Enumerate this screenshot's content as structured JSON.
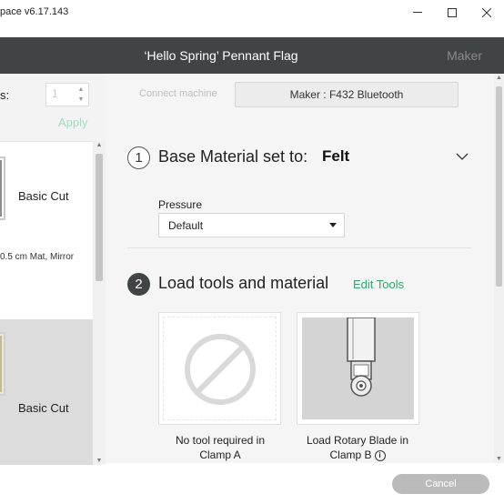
{
  "window": {
    "app_title": "pace  v6.17.143",
    "minimize_icon": "minimize-icon",
    "maximize_icon": "maximize-icon",
    "close_icon": "close-icon"
  },
  "header": {
    "back_icon": "chevron-left-icon",
    "project_title": "‘Hello Spring’ Pennant Flag",
    "machine_type": "Maker"
  },
  "copies": {
    "label": "s:",
    "value": "1",
    "apply_label": "Apply"
  },
  "mats": [
    {
      "label": "Basic Cut",
      "subtitle": "0.5 cm Mat, Mirror",
      "selected": false
    },
    {
      "label": "Basic Cut",
      "selected": true
    }
  ],
  "connect": {
    "label": "Connect machine",
    "machine": "Maker : F432 Bluetooth"
  },
  "step1": {
    "number": "1",
    "title": "Base Material set to:",
    "material": "Felt",
    "expand_icon": "chevron-down-icon"
  },
  "pressure": {
    "label": "Pressure",
    "selected": "Default"
  },
  "step2": {
    "number": "2",
    "title": "Load tools and material",
    "edit_tools": "Edit Tools"
  },
  "tools": [
    {
      "icon": "no-tool-icon",
      "caption_line1": "No tool required in",
      "caption_line2": "Clamp A"
    },
    {
      "icon": "rotary-blade-icon",
      "caption_line1": "Load Rotary Blade in",
      "caption_line2": "Clamp B",
      "info_icon": "i"
    }
  ],
  "footer": {
    "cancel_label": "Cancel"
  },
  "colors": {
    "header_bg": "#414445",
    "accent_green": "#2da66e",
    "panel_bg": "#f5f5f5"
  }
}
